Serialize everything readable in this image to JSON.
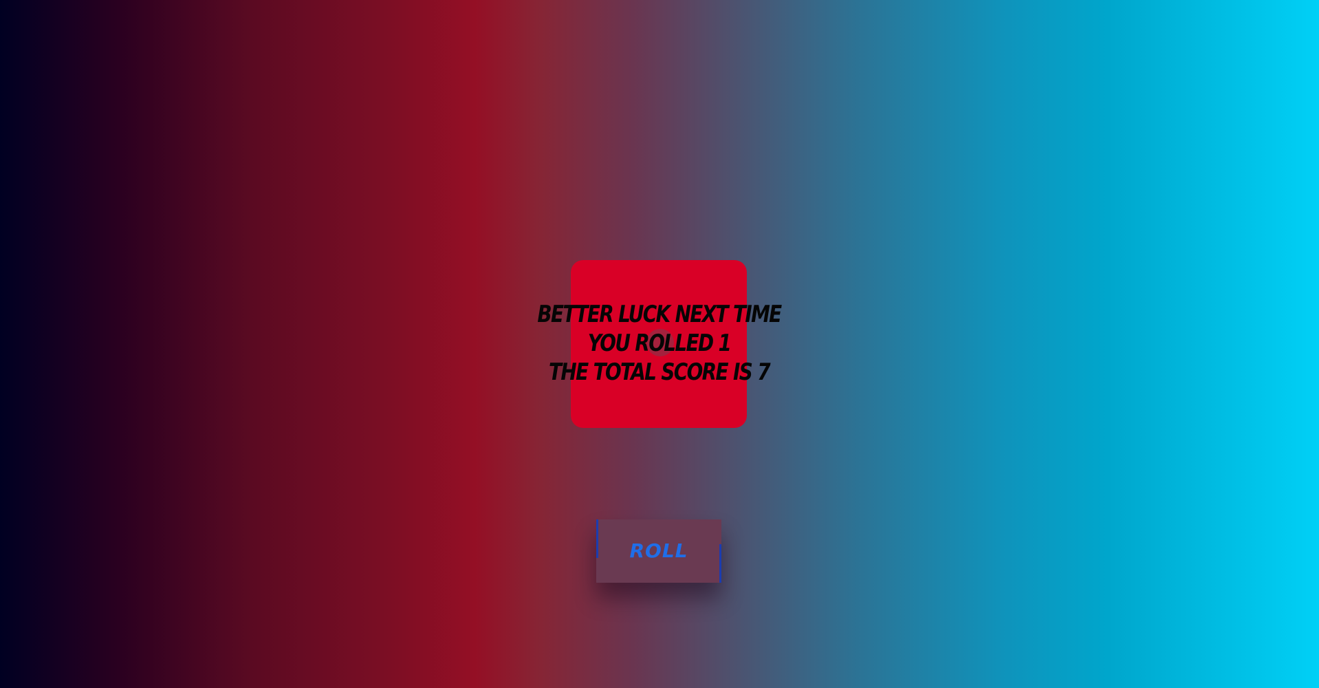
{
  "result": {
    "line1": "Better luck next time",
    "line2": "You rolled 1",
    "line3": "The total score is 7"
  },
  "die": {
    "color": "#d90026"
  },
  "controls": {
    "roll_label": "Roll",
    "roll_color": "#1f6ee8"
  }
}
